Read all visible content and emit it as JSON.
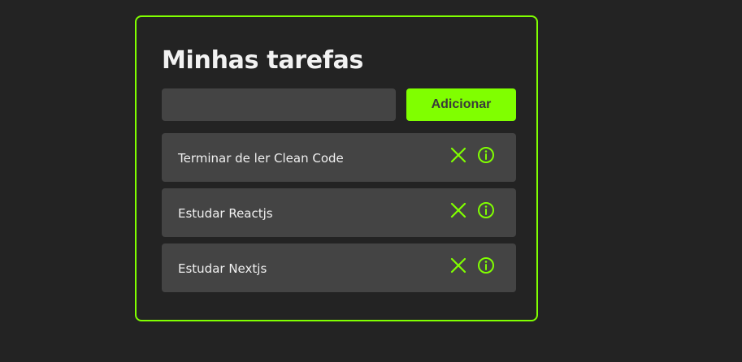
{
  "app": {
    "title": "Minhas tarefas"
  },
  "form": {
    "input_value": "",
    "input_placeholder": "",
    "add_label": "Adicionar"
  },
  "tasks": [
    {
      "title": "Terminar de ler Clean Code",
      "remove_icon": "close-icon",
      "info_icon": "info-icon"
    },
    {
      "title": "Estudar Reactjs",
      "remove_icon": "close-icon",
      "info_icon": "info-icon"
    },
    {
      "title": "Estudar Nextjs",
      "remove_icon": "close-icon",
      "info_icon": "info-icon"
    }
  ],
  "colors": {
    "accent": "#80ff00",
    "background": "#232323",
    "card": "#444444",
    "text": "#f0f0f0"
  }
}
